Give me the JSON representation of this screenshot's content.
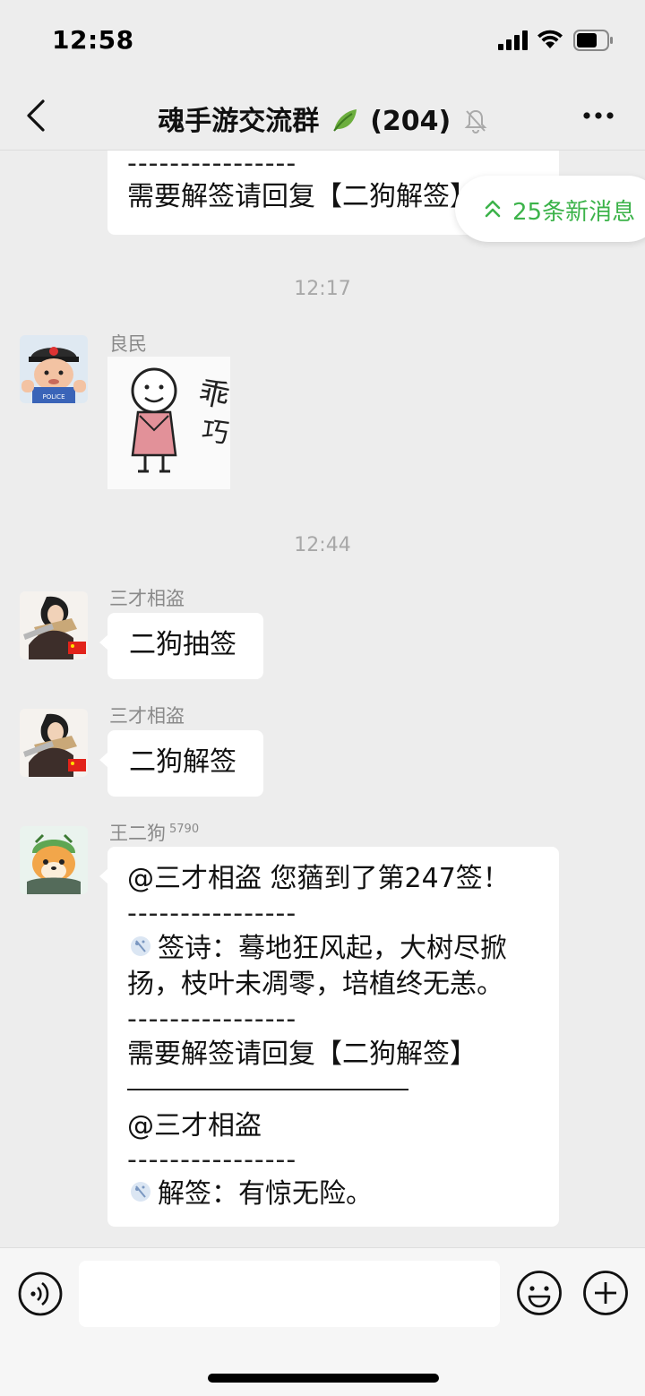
{
  "status_bar": {
    "time": "12:58"
  },
  "nav": {
    "title": "魂手游交流群",
    "count": "(204)"
  },
  "new_messages": {
    "label": "25条新消息"
  },
  "messages": {
    "partial_top": {
      "dash": "----------------",
      "text": "需要解签请回复【二狗解签】"
    },
    "time1": "12:17",
    "liangmin": {
      "sender": "良民",
      "sticker_text": "乖巧"
    },
    "time2": "12:44",
    "msg1": {
      "sender": "三才相盗",
      "text": "二狗抽签"
    },
    "msg2": {
      "sender": "三才相盗",
      "text": "二狗解签"
    },
    "bot": {
      "sender": "王二狗",
      "badge": "5790",
      "line1": "@三才相盗 您蕕到了第247签！",
      "dash1": "----------------",
      "poem_line1": "签诗：蓦地狂风起，大树尽掀",
      "poem_line2": "扬，枝叶未凋零，培植终无恙。",
      "dash2": "----------------",
      "reply_hint": "需要解签请回复【二狗解签】",
      "mention": "@三才相盗",
      "dash3": "----------------",
      "interpretation": "解签：有惊无险。"
    }
  },
  "colors": {
    "accent_green": "#3cb34a",
    "background": "#ededed",
    "bubble": "#ffffff"
  }
}
